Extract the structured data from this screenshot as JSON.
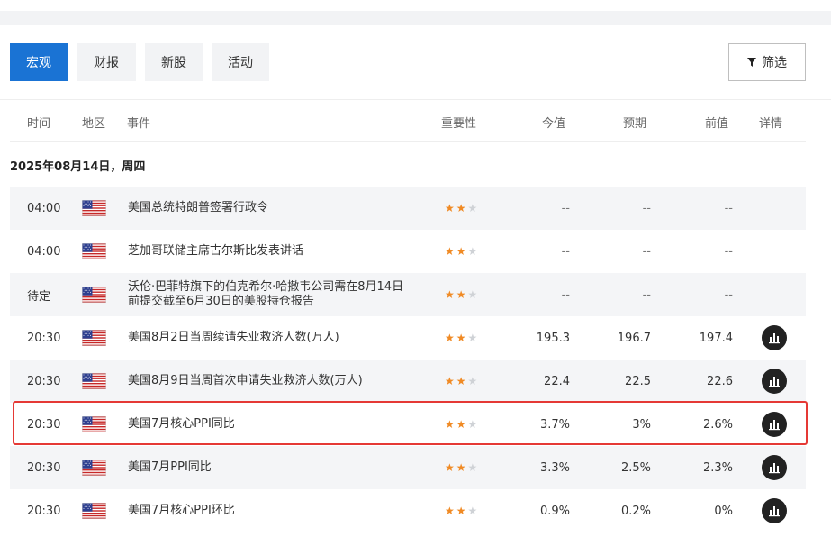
{
  "tabs": [
    {
      "label": "宏观",
      "active": true
    },
    {
      "label": "财报",
      "active": false
    },
    {
      "label": "新股",
      "active": false
    },
    {
      "label": "活动",
      "active": false
    }
  ],
  "filter": {
    "label": "筛选",
    "icon": "funnel-icon"
  },
  "columns": {
    "time": "时间",
    "region": "地区",
    "event": "事件",
    "importance": "重要性",
    "actual": "今值",
    "forecast": "预期",
    "previous": "前值",
    "detail": "详情"
  },
  "date_label": "2025年08月14日，周四",
  "rows": [
    {
      "time": "04:00",
      "flag": "us-flag-icon",
      "event": "美国总统特朗普签署行政令",
      "stars": 2,
      "actual": "--",
      "forecast": "--",
      "previous": "--",
      "has_detail": false
    },
    {
      "time": "04:00",
      "flag": "us-flag-icon",
      "event": "芝加哥联储主席古尔斯比发表讲话",
      "stars": 2,
      "actual": "--",
      "forecast": "--",
      "previous": "--",
      "has_detail": false
    },
    {
      "time": "待定",
      "flag": "us-flag-icon",
      "event": "沃伦·巴菲特旗下的伯克希尔·哈撒韦公司需在8月14日前提交截至6月30日的美股持仓报告",
      "stars": 2,
      "actual": "--",
      "forecast": "--",
      "previous": "--",
      "has_detail": false
    },
    {
      "time": "20:30",
      "flag": "us-flag-icon",
      "event": "美国8月2日当周续请失业救济人数(万人)",
      "stars": 2,
      "actual": "195.3",
      "forecast": "196.7",
      "previous": "197.4",
      "has_detail": true
    },
    {
      "time": "20:30",
      "flag": "us-flag-icon",
      "event": "美国8月9日当周首次申请失业救济人数(万人)",
      "stars": 2,
      "actual": "22.4",
      "forecast": "22.5",
      "previous": "22.6",
      "has_detail": true
    },
    {
      "time": "20:30",
      "flag": "us-flag-icon",
      "event": "美国7月核心PPI同比",
      "stars": 2,
      "actual": "3.7%",
      "forecast": "3%",
      "previous": "2.6%",
      "has_detail": true,
      "highlighted": true
    },
    {
      "time": "20:30",
      "flag": "us-flag-icon",
      "event": "美国7月PPI同比",
      "stars": 2,
      "actual": "3.3%",
      "forecast": "2.5%",
      "previous": "2.3%",
      "has_detail": true
    },
    {
      "time": "20:30",
      "flag": "us-flag-icon",
      "event": "美国7月核心PPI环比",
      "stars": 2,
      "actual": "0.9%",
      "forecast": "0.2%",
      "previous": "0%",
      "has_detail": true
    }
  ],
  "colors": {
    "accent": "#1a73d4",
    "star_on": "#f08a24",
    "star_off": "#cfd2d6",
    "highlight": "#e53935"
  }
}
